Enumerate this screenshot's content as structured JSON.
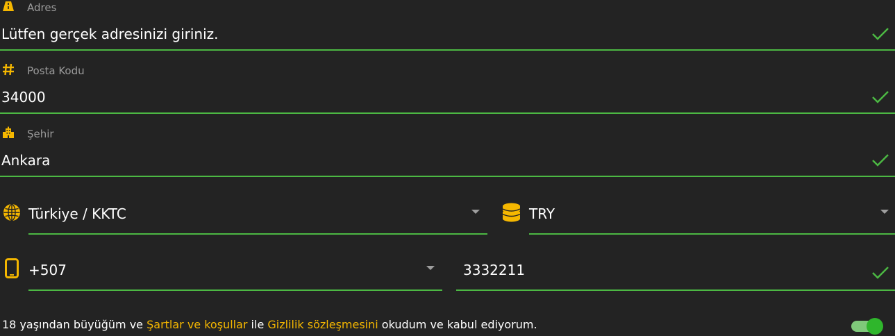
{
  "colors": {
    "background": "#232323",
    "accent_green": "#4cb843",
    "icon_yellow": "#f5b700",
    "label_gray": "#9b9b9b"
  },
  "address": {
    "label": "Adres",
    "value": "Lütfen gerçek adresinizi giriniz.",
    "icon": "road-icon",
    "valid": true
  },
  "postal": {
    "label": "Posta Kodu",
    "value": "34000",
    "icon": "hash-icon",
    "valid": true
  },
  "city": {
    "label": "Şehir",
    "value": "Ankara",
    "icon": "city-icon",
    "valid": true
  },
  "country": {
    "value": "Türkiye / KKTC",
    "icon": "globe-icon"
  },
  "currency": {
    "value": "TRY",
    "icon": "coins-icon"
  },
  "phone": {
    "prefix": "+507",
    "number": "3332211",
    "icon": "mobile-phone-icon",
    "valid": true
  },
  "consent": {
    "text_start": "18 yaşından büyüğüm ve ",
    "link_terms": "Şartlar ve koşullar",
    "text_mid": " ile ",
    "link_privacy": "Gizlilik sözleşmesini",
    "text_end": " okudum ve kabul ediyorum.",
    "toggle_on": true
  }
}
